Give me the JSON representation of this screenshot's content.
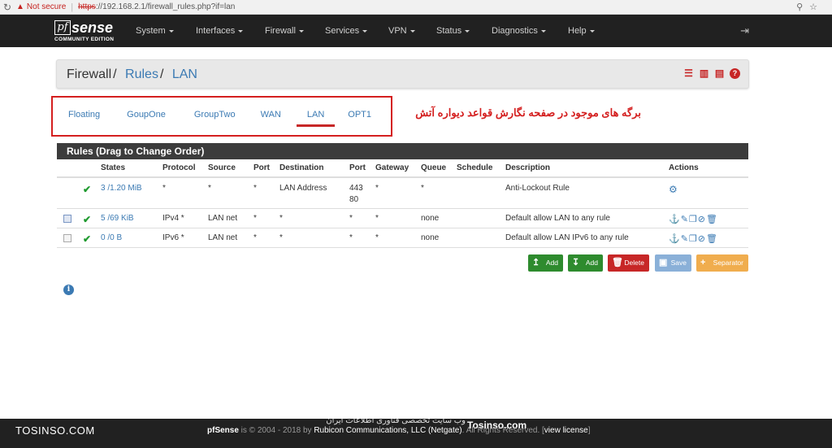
{
  "browser": {
    "warning_label": "Not secure",
    "protocol": "https",
    "url_rest": "://192.168.2.1/firewall_rules.php?if=lan"
  },
  "nav": {
    "logo_mark": "pf",
    "logo_word": "sense",
    "logo_edition": "COMMUNITY EDITION",
    "items": [
      "System",
      "Interfaces",
      "Firewall",
      "Services",
      "VPN",
      "Status",
      "Diagnostics",
      "Help"
    ]
  },
  "breadcrumb": {
    "root": "Firewall",
    "section": "Rules",
    "page": "LAN"
  },
  "tabs": [
    "Floating",
    "GoupOne",
    "GroupTwo",
    "WAN",
    "LAN",
    "OPT1"
  ],
  "active_tab": "LAN",
  "annotation": "برگه های موجود در صفحه نگارش قواعد دیواره آتش",
  "rules_panel": {
    "title": "Rules (Drag to Change Order)",
    "columns": [
      "",
      "",
      "States",
      "Protocol",
      "Source",
      "Port",
      "Destination",
      "Port",
      "Gateway",
      "Queue",
      "Schedule",
      "Description",
      "Actions"
    ],
    "rows": [
      {
        "states": "3 /1.20 MiB",
        "protocol": "*",
        "source": "*",
        "sport": "*",
        "destination": "LAN Address",
        "dport_a": "443",
        "dport_b": "80",
        "gateway": "*",
        "queue": "*",
        "schedule": "",
        "description": "Anti-Lockout Rule"
      },
      {
        "states": "5 /69 KiB",
        "protocol": "IPv4 *",
        "source": "LAN net",
        "sport": "*",
        "destination": "*",
        "dport_a": "*",
        "dport_b": "",
        "gateway": "*",
        "queue": "none",
        "schedule": "",
        "description": "Default allow LAN to any rule"
      },
      {
        "states": "0 /0 B",
        "protocol": "IPv6 *",
        "source": "LAN net",
        "sport": "*",
        "destination": "*",
        "dport_a": "*",
        "dport_b": "",
        "gateway": "*",
        "queue": "none",
        "schedule": "",
        "description": "Default allow LAN IPv6 to any rule"
      }
    ]
  },
  "buttons": {
    "add_top": "Add",
    "add_bottom": "Add",
    "delete": "Delete",
    "save": "Save",
    "separator": "Separator"
  },
  "footer": {
    "brand": "TOSINSO.COM",
    "product": "pfSense",
    "copyright": " is © 2004 - 2018 by ",
    "company": "Rubicon Communications, LLC (Netgate)",
    "rights": ". All Rights Reserved. [",
    "license": "view license",
    "close": "]",
    "watermark_site": "Tosinso.com",
    "watermark_fa": "وب سایت تخصصی فناوری اطلاعات ایران"
  },
  "colors": {
    "navbar": "#212121",
    "link": "#3b7ab3",
    "accent_red": "#c72727",
    "add_green": "#2e8b2e",
    "delete_red": "#c72727",
    "save_blue": "#8ab0d8",
    "separator_orange": "#f0ad4e"
  }
}
